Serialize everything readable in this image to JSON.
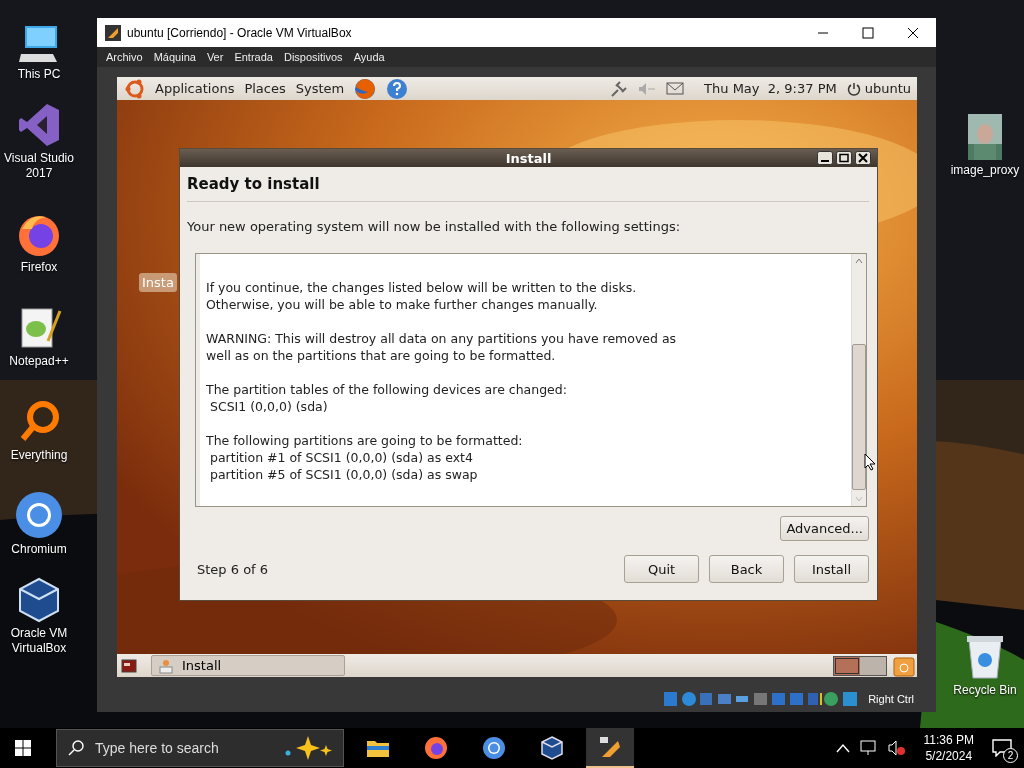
{
  "desktop_icons_left": [
    {
      "label": "This PC",
      "kind": "pc"
    },
    {
      "label": "Visual Studio\n2017",
      "kind": "vs"
    },
    {
      "label": "Firefox",
      "kind": "firefox"
    },
    {
      "label": "Notepad++",
      "kind": "notepad"
    },
    {
      "label": "Everything",
      "kind": "everything"
    },
    {
      "label": "Chromium",
      "kind": "chromium"
    },
    {
      "label": "Oracle VM\nVirtualBox",
      "kind": "vbox"
    }
  ],
  "desktop_icons_right": [
    {
      "label": "image_proxy"
    },
    {
      "label": "Recycle Bin",
      "kind": "bin"
    }
  ],
  "window": {
    "title": "ubuntu [Corriendo] - Oracle VM VirtualBox",
    "menu": [
      "Archivo",
      "Máquina",
      "Ver",
      "Entrada",
      "Dispositivos",
      "Ayuda"
    ],
    "guest": {
      "top_panel": {
        "menus": [
          "Applications",
          "Places",
          "System"
        ],
        "clock": "Thu May  2, 9:37 PM",
        "user": "ubuntu"
      },
      "desktop_icon_label": "Insta",
      "dialog": {
        "title": "Install",
        "heading": "Ready to install",
        "intro": "Your new operating system will now be installed with the following settings:",
        "paragraphs": [
          [
            {
              "text": "If you continue, the changes listed below will be written to the disks.",
              "kind": "line"
            },
            {
              "text": "Otherwise, you will be able to make further changes manually.",
              "kind": "line"
            }
          ],
          [
            {
              "text": "WARNING: This will destroy all data on any partitions you have removed as",
              "kind": "line"
            },
            {
              "text": "well as on the partitions that are going to be formatted.",
              "kind": "line"
            }
          ],
          [
            {
              "text": "The partition tables of the following devices are changed:",
              "kind": "line"
            },
            {
              "text": "SCSI1 (0,0,0) (sda)",
              "kind": "item"
            }
          ],
          [
            {
              "text": "The following partitions are going to be formatted:",
              "kind": "line"
            },
            {
              "text": "partition #1 of SCSI1 (0,0,0) (sda) as ext4",
              "kind": "item"
            },
            {
              "text": "partition #5 of SCSI1 (0,0,0) (sda) as swap",
              "kind": "item"
            }
          ]
        ],
        "advanced": "Advanced...",
        "step": "Step 6 of 6",
        "buttons": [
          "Quit",
          "Back",
          "Install"
        ]
      },
      "bottom_panel": {
        "task": "Install",
        "workspaces": [
          {
            "selected": true
          },
          {
            "selected": false
          }
        ]
      }
    },
    "host_key": "Right Ctrl"
  },
  "taskbar": {
    "search_placeholder": "Type here to search",
    "time": "11:36 PM",
    "date": "5/2/2024",
    "notifications": "2"
  }
}
